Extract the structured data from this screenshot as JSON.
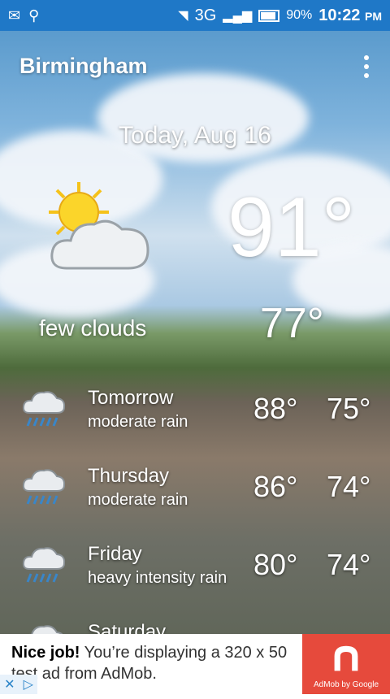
{
  "status_bar": {
    "network": "3G",
    "battery": "90%",
    "time": "10:22",
    "ampm": "PM"
  },
  "header": {
    "city": "Birmingham"
  },
  "today": {
    "date": "Today, Aug 16",
    "high": "91°",
    "low": "77°",
    "condition": "few clouds",
    "icon": "sun-cloud-icon"
  },
  "forecast": [
    {
      "day": "Tomorrow",
      "condition": "moderate rain",
      "high": "88°",
      "low": "75°",
      "icon": "rain-cloud-icon"
    },
    {
      "day": "Thursday",
      "condition": "moderate rain",
      "high": "86°",
      "low": "74°",
      "icon": "rain-cloud-icon"
    },
    {
      "day": "Friday",
      "condition": "heavy intensity rain",
      "high": "80°",
      "low": "74°",
      "icon": "rain-cloud-icon"
    },
    {
      "day": "Saturday",
      "condition": "",
      "high": "",
      "low": "",
      "icon": "cloud-icon"
    }
  ],
  "ad": {
    "headline": "Nice job!",
    "body": "You’re displaying a 320 x 50 test ad from AdMob.",
    "brand": "AdMob by Google"
  }
}
